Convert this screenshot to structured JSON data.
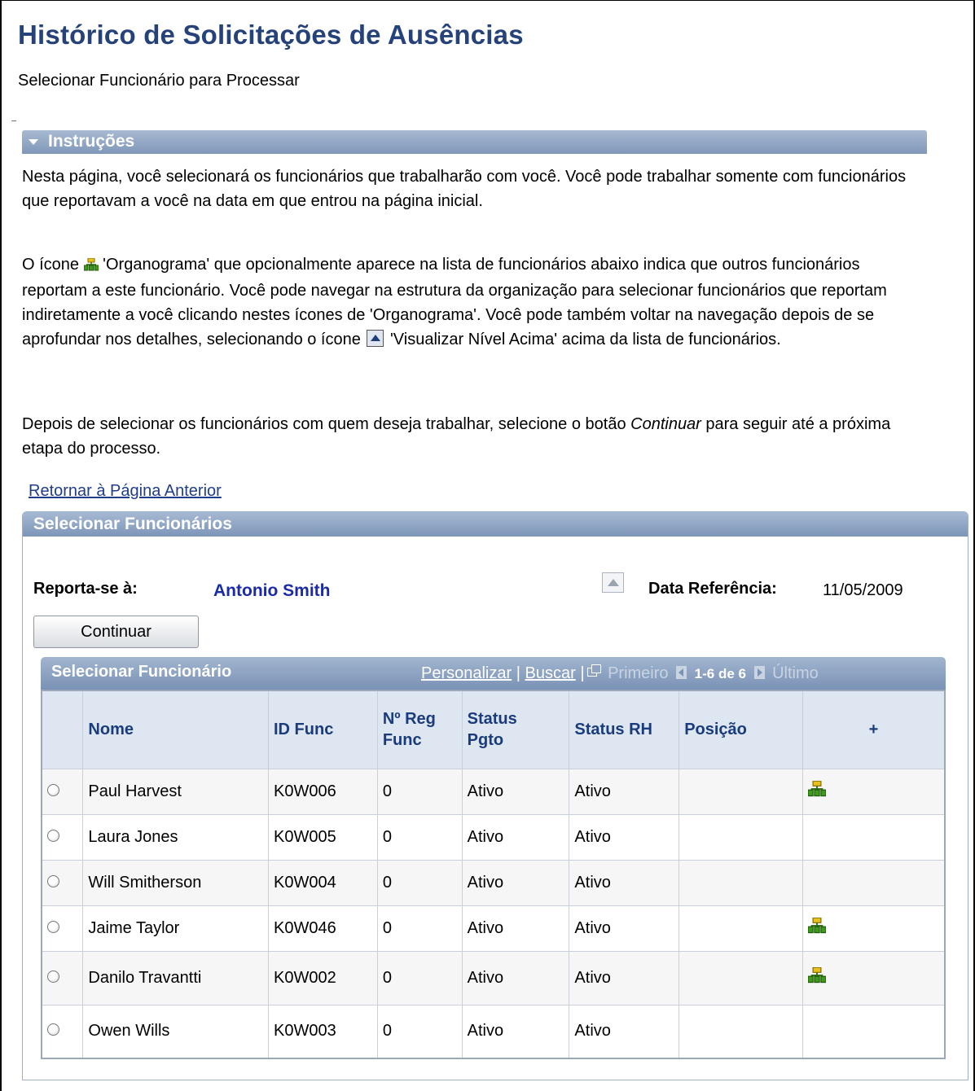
{
  "page": {
    "title": "Histórico de Solicitações de Ausências",
    "subtitle": "Selecionar Funcionário para Processar"
  },
  "instructions": {
    "header": "Instruções",
    "para1": "Nesta página, você selecionará os funcionários que trabalharão com você. Você pode trabalhar somente com funcionários que reportavam a você na data em que entrou na página inicial.",
    "para2_before_icon": "O ícone ",
    "para2_after_icon": " 'Organograma' que opcionalmente aparece na lista de funcionários abaixo indica que outros funcionários reportam a este funcionário. Você pode navegar na estrutura da organização para selecionar funcionários que reportam indiretamente a você clicando nestes ícones de 'Organograma'. Você pode também voltar na navegação depois de se aprofundar nos detalhes, selecionando o ícone ",
    "para2_end": " 'Visualizar Nível Acima' acima da lista de funcionários.",
    "para3_before": "Depois de selecionar os funcionários com quem deseja trabalhar, selecione o botão ",
    "para3_emph": "Continuar",
    "para3_after": " para seguir até a próxima etapa do processo."
  },
  "back_link": "Retornar à Página Anterior",
  "panel": {
    "title": "Selecionar Funcionários",
    "reports_label": "Reporta-se à:",
    "reports_name": "Antonio Smith",
    "date_label": "Data Referência:",
    "date_value": "11/05/2009",
    "continue_label": "Continuar"
  },
  "grid": {
    "title": "Selecionar Funcionário",
    "personalize": "Personalizar",
    "search": "Buscar",
    "first": "Primeiro",
    "range": "1-6 de 6",
    "last": "Último",
    "columns": {
      "name": "Nome",
      "id": "ID Func",
      "reg_line1": "Nº Reg",
      "reg_line2": "Func",
      "pay_line1": "Status",
      "pay_line2": "Pgto",
      "hr": "Status RH",
      "position": "Posição",
      "plus": "+"
    },
    "rows": [
      {
        "name": "Paul Harvest",
        "id": "K0W006",
        "reg": "0",
        "pay": "Ativo",
        "hr": "Ativo",
        "position": "",
        "org": true
      },
      {
        "name": "Laura Jones",
        "id": "K0W005",
        "reg": "0",
        "pay": "Ativo",
        "hr": "Ativo",
        "position": "",
        "org": false
      },
      {
        "name": "Will Smitherson",
        "id": "K0W004",
        "reg": "0",
        "pay": "Ativo",
        "hr": "Ativo",
        "position": "",
        "org": false
      },
      {
        "name": "Jaime Taylor",
        "id": "K0W046",
        "reg": "0",
        "pay": "Ativo",
        "hr": "Ativo",
        "position": "",
        "org": true
      },
      {
        "name": "Danilo Travantti",
        "id": "K0W002",
        "reg": "0",
        "pay": "Ativo",
        "hr": "Ativo",
        "position": "",
        "org": true
      },
      {
        "name": "Owen Wills",
        "id": "K0W003",
        "reg": "0",
        "pay": "Ativo",
        "hr": "Ativo",
        "position": "",
        "org": false
      }
    ]
  },
  "icons": {
    "org_chart": "org-chart-icon",
    "view_level_up": "view-level-up-icon"
  },
  "colors": {
    "title": "#26427a",
    "header_bar": "#7f97b9",
    "link": "#1f3d8a",
    "reports_name": "#1b2ba8"
  }
}
